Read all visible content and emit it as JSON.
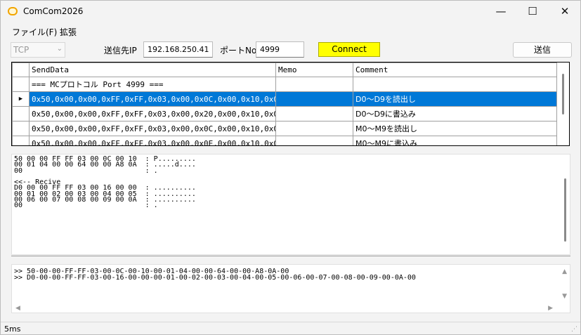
{
  "window": {
    "title": "ComCom2026",
    "minimize": "—",
    "maximize": "☐",
    "close": "✕"
  },
  "menu": {
    "file": "ファイル(F)",
    "extend": "拡張"
  },
  "toolbar": {
    "protocol": "TCP",
    "ip_label": "送信先IP",
    "ip_value": "192.168.250.41",
    "port_label": "ポートNo",
    "port_value": "4999",
    "connect_label": "Connect",
    "send_label": "送信"
  },
  "grid": {
    "headers": {
      "senddata": "SendData",
      "memo": "Memo",
      "comment": "Comment"
    },
    "rows": [
      {
        "senddata": "=== MCプロトコル Port 4999 ===",
        "memo": "",
        "comment": "",
        "marker": ""
      },
      {
        "senddata": "0x50,0x00,0x00,0xFF,0xFF,0x03,0x00,0x0C,0x00,0x10,0x00...",
        "memo": "",
        "comment": "D0～D9を読出し",
        "marker": "▶"
      },
      {
        "senddata": "0x50,0x00,0x00,0xFF,0xFF,0x03,0x00,0x20,0x00,0x10,0x00...",
        "memo": "",
        "comment": "D0～D9に書込み",
        "marker": ""
      },
      {
        "senddata": "0x50,0x00,0x00,0xFF,0xFF,0x03,0x00,0x0C,0x00,0x10,0x00...",
        "memo": "",
        "comment": "M0～M9を読出し",
        "marker": ""
      },
      {
        "senddata": "0x50,0x00,0x00,0xFF,0xFF,0x03,0x00,0x0E,0x00,0x10,0x00...",
        "memo": "",
        "comment": "M0～M9に書込み",
        "marker": ""
      }
    ]
  },
  "hexdump": "50 00 00 FF FF 03 00 0C 00 10  : P.........\n00 01 04 00 00 64 00 00 A8 0A  : .....d....\n00                             : .\n\n<<-- Recive\nD0 00 00 FF FF 03 00 16 00 00  : ..........\n00 01 00 02 00 03 00 04 00 05  : ..........\n00 06 00 07 00 08 00 09 00 0A  : ..........\n00                             : .",
  "log": ">> 50-00-00-FF-FF-03-00-0C-00-10-00-01-04-00-00-64-00-00-A8-0A-00\n>> D0-00-00-FF-FF-03-00-16-00-00-00-01-00-02-00-03-00-04-00-05-00-06-00-07-00-08-00-09-00-0A-00",
  "status": {
    "text": "5ms"
  },
  "colors": {
    "connect": "#ffff00",
    "selection": "#0078d7",
    "app_icon": "#f2a500"
  }
}
